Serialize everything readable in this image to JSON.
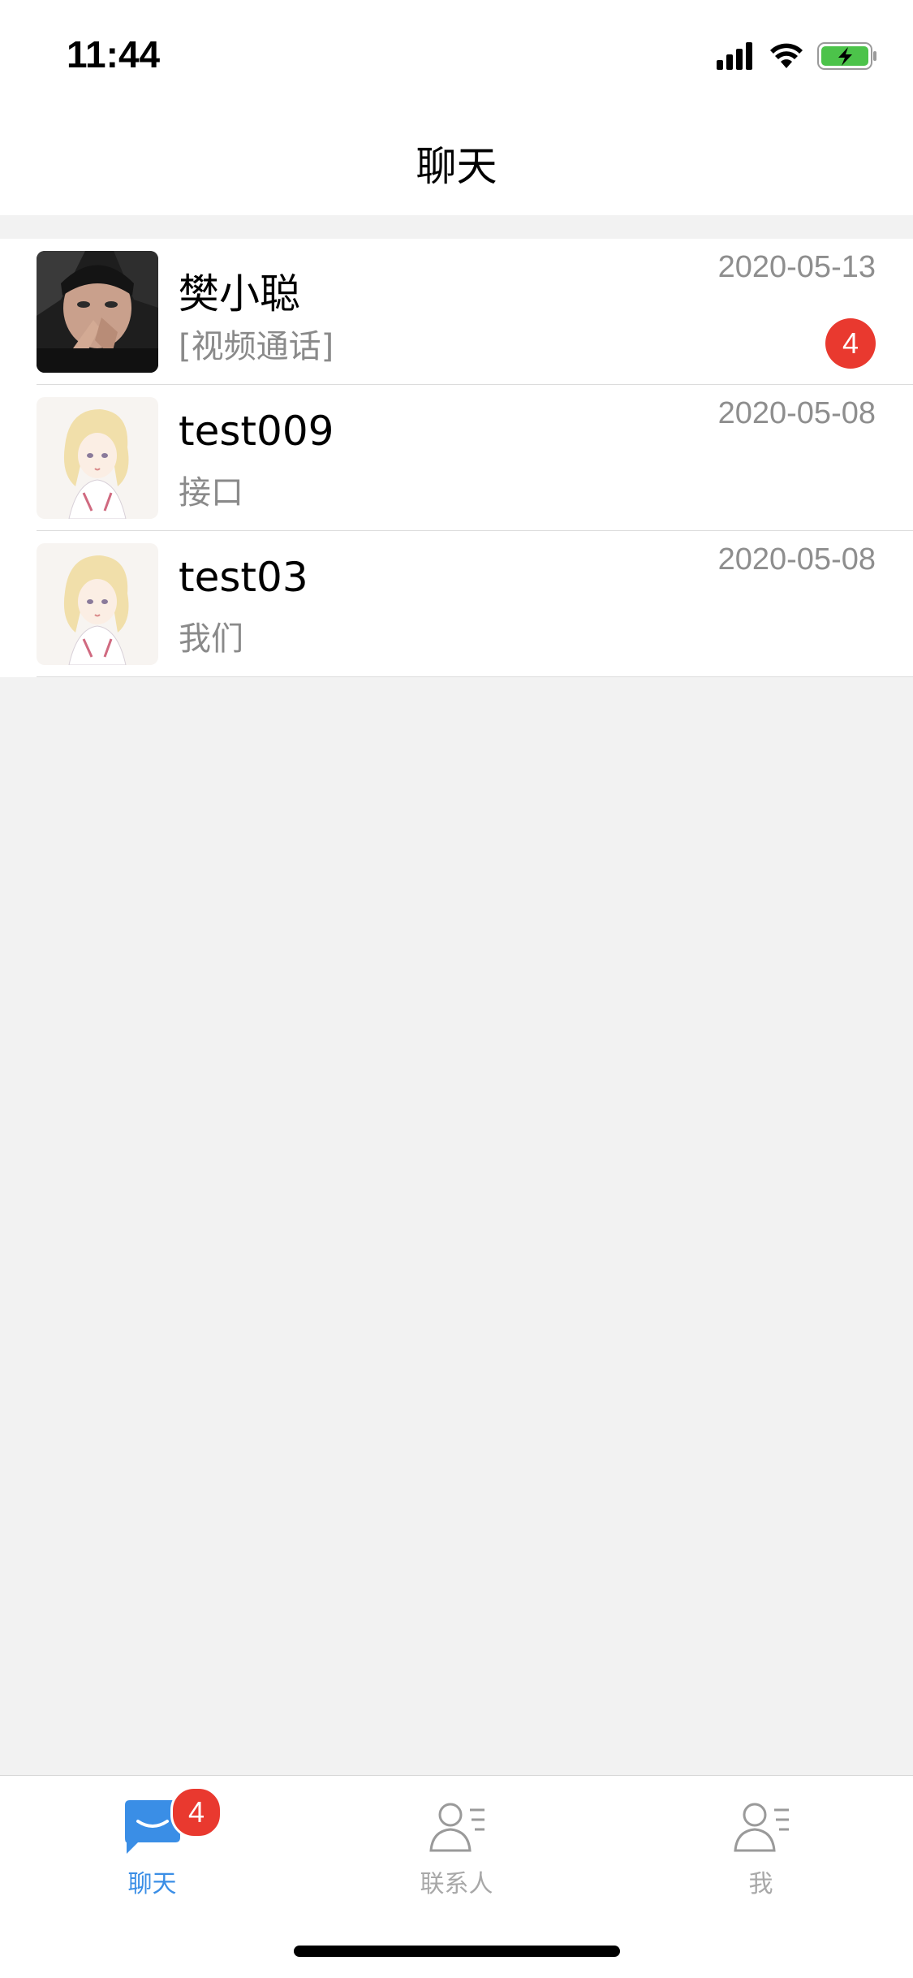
{
  "status_bar": {
    "time": "11:44",
    "icons": [
      "signal-icon",
      "wifi-icon",
      "battery-charging-icon"
    ]
  },
  "nav": {
    "title": "聊天"
  },
  "chats": [
    {
      "name": "樊小聪",
      "preview": "[视频通话]",
      "date": "2020-05-13",
      "unread": "4",
      "avatar": "photo-avatar"
    },
    {
      "name": "test009",
      "preview": "接口",
      "date": "2020-05-08",
      "unread": "",
      "avatar": "illustration-avatar"
    },
    {
      "name": "test03",
      "preview": "我们",
      "date": "2020-05-08",
      "unread": "",
      "avatar": "illustration-avatar"
    }
  ],
  "tabs": [
    {
      "label": "聊天",
      "icon": "chat-bubble-icon",
      "badge": "4",
      "active": true
    },
    {
      "label": "联系人",
      "icon": "contacts-icon",
      "badge": "",
      "active": false
    },
    {
      "label": "我",
      "icon": "profile-icon",
      "badge": "",
      "active": false
    }
  ],
  "colors": {
    "accent": "#3a8ee6",
    "badge": "#e9392f",
    "background": "#f2f2f2"
  }
}
